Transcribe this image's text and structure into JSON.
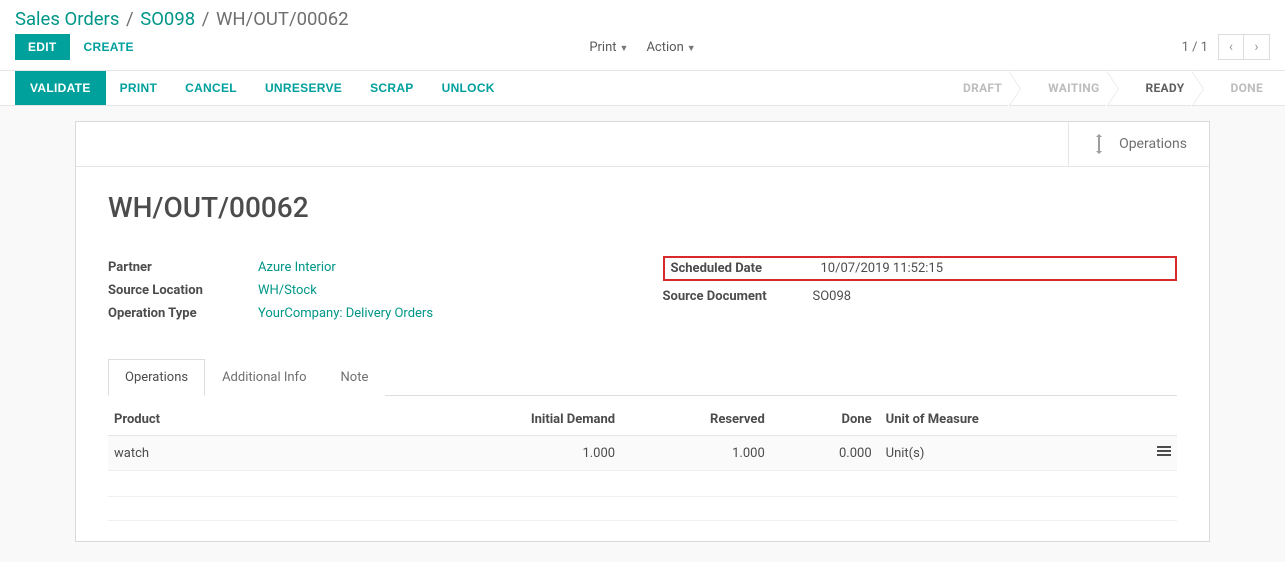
{
  "breadcrumb": {
    "parent1": "Sales Orders",
    "parent2": "SO098",
    "current": "WH/OUT/00062"
  },
  "topbar": {
    "edit": "EDIT",
    "create": "CREATE",
    "print": "Print",
    "action": "Action",
    "pager": "1 / 1"
  },
  "toolbar": {
    "validate": "VALIDATE",
    "print": "PRINT",
    "cancel": "CANCEL",
    "unreserve": "UNRESERVE",
    "scrap": "SCRAP",
    "unlock": "UNLOCK"
  },
  "status": {
    "draft": "DRAFT",
    "waiting": "WAITING",
    "ready": "READY",
    "done": "DONE"
  },
  "statbtn": {
    "operations": "Operations"
  },
  "doc": {
    "title": "WH/OUT/00062",
    "partner_label": "Partner",
    "partner_value": "Azure Interior",
    "srcloc_label": "Source Location",
    "srcloc_value": "WH/Stock",
    "optype_label": "Operation Type",
    "optype_value": "YourCompany: Delivery Orders",
    "sched_label": "Scheduled Date",
    "sched_value": "10/07/2019 11:52:15",
    "srcdoc_label": "Source Document",
    "srcdoc_value": "SO098"
  },
  "tabs": {
    "operations": "Operations",
    "additional": "Additional Info",
    "note": "Note"
  },
  "table": {
    "headers": {
      "product": "Product",
      "initial": "Initial Demand",
      "reserved": "Reserved",
      "done": "Done",
      "uom": "Unit of Measure"
    },
    "rows": [
      {
        "product": "watch",
        "initial": "1.000",
        "reserved": "1.000",
        "done": "0.000",
        "uom": "Unit(s)"
      }
    ]
  }
}
